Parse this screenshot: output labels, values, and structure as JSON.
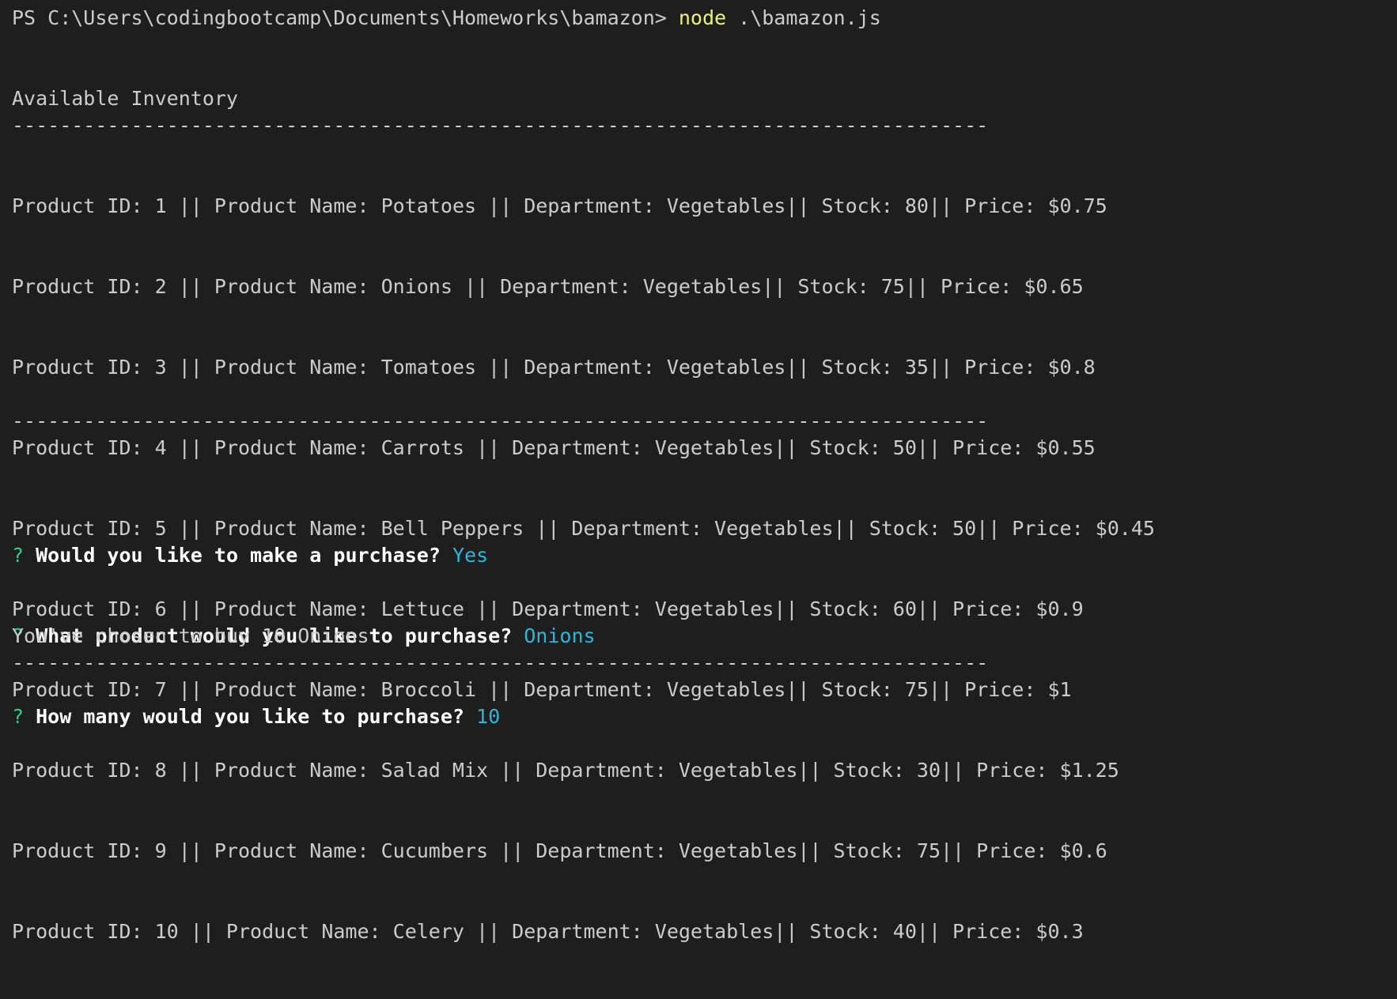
{
  "terminal": {
    "command_line": {
      "prompt": "PS C:\\Users\\codingbootcamp\\Documents\\Homeworks\\bamazon> ",
      "command": "node",
      "args": " .\\bamazon.js"
    },
    "inventory_header": "Available Inventory",
    "separator": "----------------------------------------------------------------------------------",
    "inventory": [
      "Product ID: 1 || Product Name: Potatoes || Department: Vegetables|| Stock: 80|| Price: $0.75",
      "Product ID: 2 || Product Name: Onions || Department: Vegetables|| Stock: 75|| Price: $0.65",
      "Product ID: 3 || Product Name: Tomatoes || Department: Vegetables|| Stock: 35|| Price: $0.8",
      "Product ID: 4 || Product Name: Carrots || Department: Vegetables|| Stock: 50|| Price: $0.55",
      "Product ID: 5 || Product Name: Bell Peppers || Department: Vegetables|| Stock: 50|| Price: $0.45",
      "Product ID: 6 || Product Name: Lettuce || Department: Vegetables|| Stock: 60|| Price: $0.9",
      "Product ID: 7 || Product Name: Broccoli || Department: Vegetables|| Stock: 75|| Price: $1",
      "Product ID: 8 || Product Name: Salad Mix || Department: Vegetables|| Stock: 30|| Price: $1.25",
      "Product ID: 9 || Product Name: Cucumbers || Department: Vegetables|| Stock: 75|| Price: $0.6",
      "Product ID: 10 || Product Name: Celery || Department: Vegetables|| Stock: 40|| Price: $0.3"
    ],
    "prompts": [
      {
        "mark": "?",
        "question": "Would you like to make a purchase?",
        "answer": "Yes"
      },
      {
        "mark": "?",
        "question": "What product would you like to purchase?",
        "answer": "Onions"
      },
      {
        "mark": "?",
        "question": "How many would you like to purchase?",
        "answer": "10"
      }
    ],
    "result": "You've chosen to buy 10 Onions"
  },
  "colors": {
    "background": "#1e1e1e",
    "text": "#cccccc",
    "command_highlight": "#f0f07a",
    "question_mark": "#23d18b",
    "answer": "#29b8db"
  }
}
